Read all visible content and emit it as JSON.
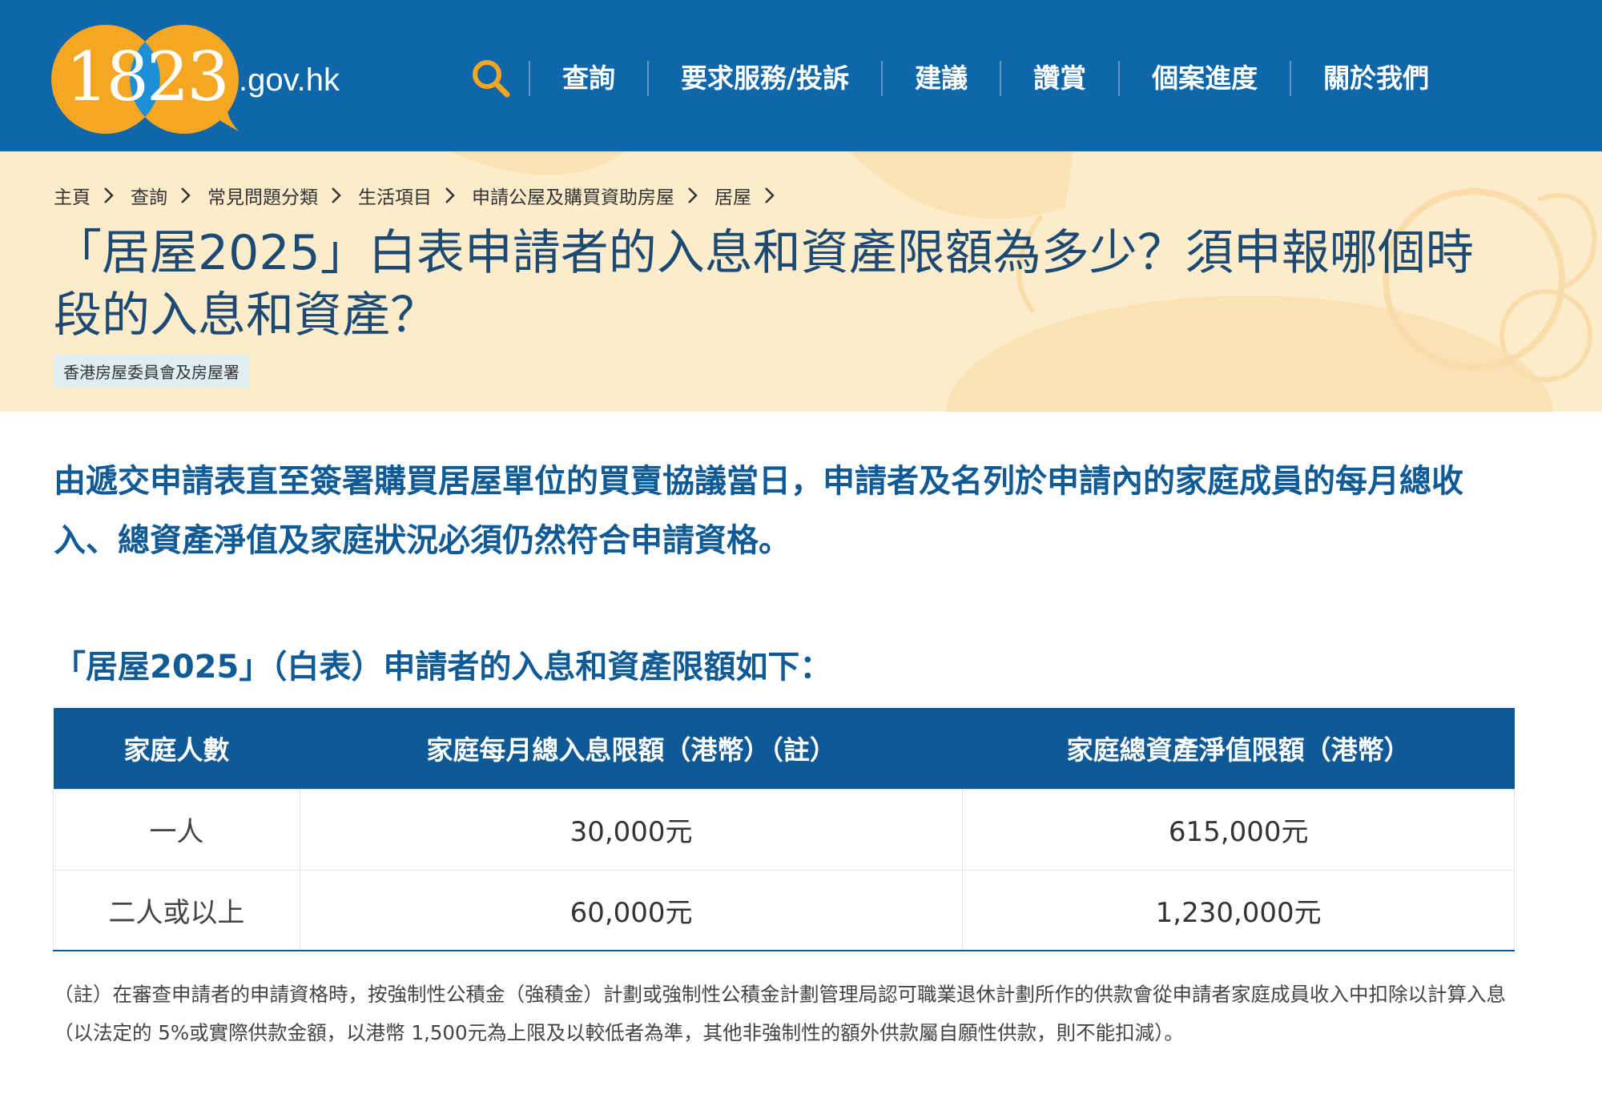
{
  "site": {
    "logo_number": "1823",
    "logo_domain": ".gov.hk"
  },
  "nav": {
    "search_icon": "search-icon",
    "items": [
      "查詢",
      "要求服務/投訴",
      "建議",
      "讚賞",
      "個案進度",
      "關於我們"
    ]
  },
  "breadcrumb": [
    "主頁",
    "查詢",
    "常見問題分類",
    "生活項目",
    "申請公屋及購買資助房屋",
    "居屋"
  ],
  "page": {
    "title": "「居屋2025」白表申請者的入息和資產限額為多少？須申報哪個時段的入息和資產？",
    "department": "香港房屋委員會及房屋署"
  },
  "content": {
    "intro": "由遞交申請表直至簽署購買居屋單位的買賣協議當日，申請者及名列於申請內的家庭成員的每月總收入、總資產淨值及家庭狀況必須仍然符合申請資格。",
    "subtitle": "「居屋2025」（白表）申請者的入息和資產限額如下：",
    "table": {
      "headers": [
        "家庭人數",
        "家庭每月總入息限額（港幣）（註）",
        "家庭總資產淨值限額（港幣）"
      ],
      "rows": [
        [
          "一人",
          "30,000元",
          "615,000元"
        ],
        [
          "二人或以上",
          "60,000元",
          "1,230,000元"
        ]
      ]
    },
    "note": "（註）在審查申請者的申請資格時，按強制性公積金（強積金）計劃或強制性公積金計劃管理局認可職業退休計劃所作的供款會從申請者家庭成員收入中扣除以計算入息（以法定的 5%或實際供款金額，以港幣 1,500元為上限及以較低者為準，其他非強制性的額外供款屬自願性供款，則不能扣減）。"
  },
  "colors": {
    "header_blue": "#0f66a9",
    "table_header_blue": "#0f5a96",
    "heading_text_blue": "#105a96",
    "logo_orange": "#f5a623",
    "search_icon_orange": "#f5a623",
    "hero_bg": "#fdeccc"
  }
}
